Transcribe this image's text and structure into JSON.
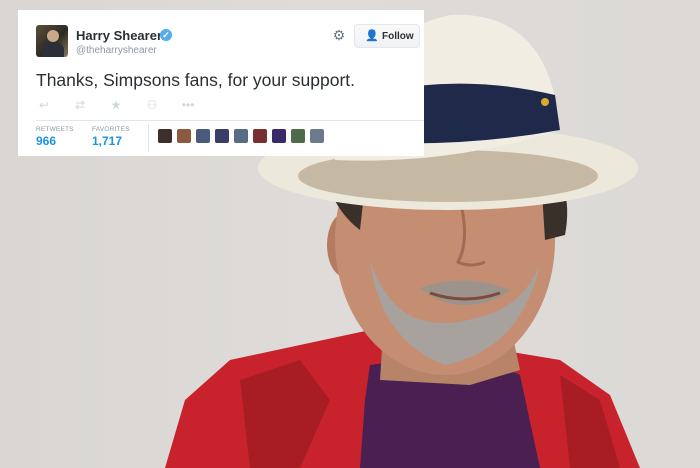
{
  "tweet": {
    "display_name": "Harry Shearer",
    "handle": "@theharryshearer",
    "verified_mark": "✓",
    "follow_label": "Follow",
    "text": "Thanks, Simpsons fans, for your support.",
    "stats": {
      "retweets_label": "RETWEETS",
      "retweets_value": "966",
      "favorites_label": "FAVORITES",
      "favorites_value": "1,717"
    },
    "action_icons": [
      "reply-icon",
      "retweet-icon",
      "favorite-icon",
      "follow-user-icon",
      "more-icon"
    ],
    "favoriter_avatar_colors": [
      "#3c2f2a",
      "#8b5a3c",
      "#4a5a7a",
      "#3a3d6a",
      "#5a6b86",
      "#7a3030",
      "#3b2a6a",
      "#4f6a4a",
      "#6a7a8f"
    ]
  },
  "colors": {
    "link_blue": "#1b95e0",
    "verified_blue": "#55acee",
    "text_dark": "#292f33",
    "muted_gray": "#8899a6"
  }
}
